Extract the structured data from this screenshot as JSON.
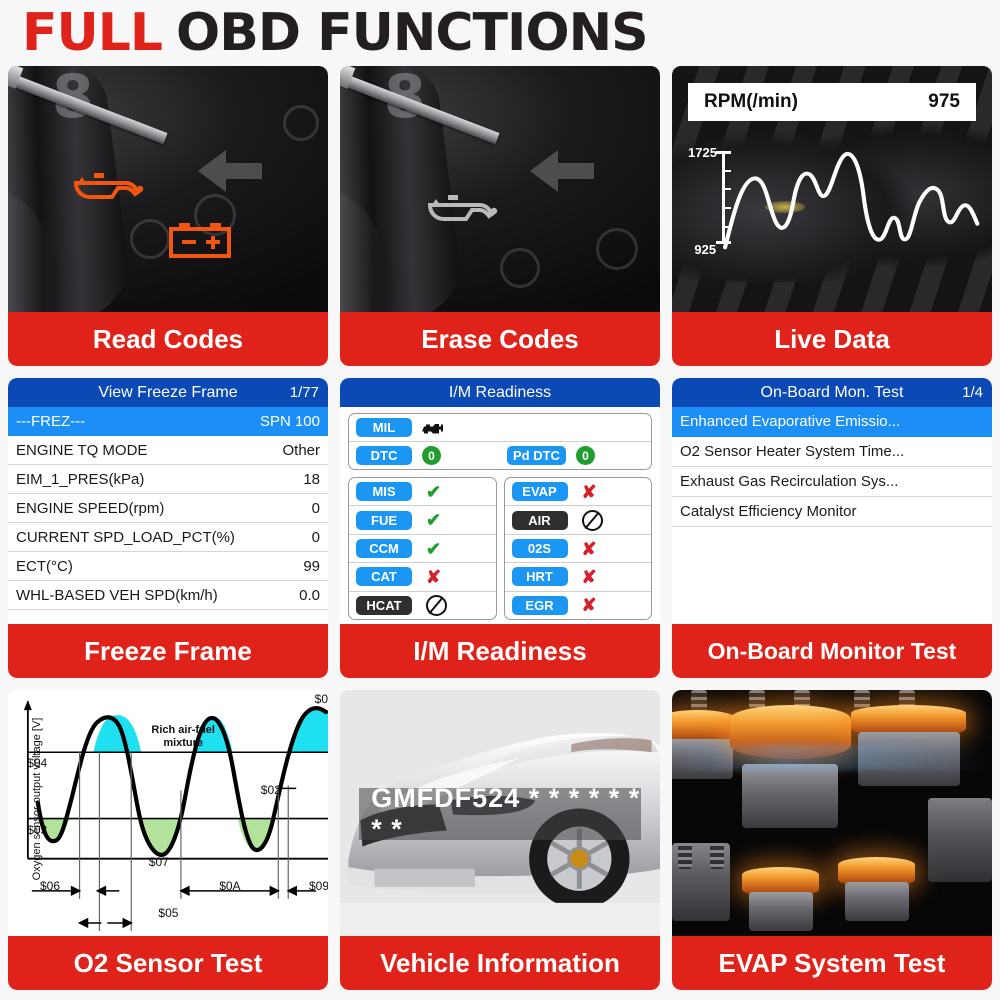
{
  "title": {
    "accent_word": "FULL",
    "rest": "OBD FUNCTIONS",
    "accent_color": "#e0231a",
    "text_color": "#231f20"
  },
  "theme": {
    "label_red": "#e0231a",
    "header_blue": "#0b49b5",
    "select_blue": "#1b8ff5",
    "badge_blue": "#1b96f3",
    "badge_dark": "#2f2f2f",
    "ok_green": "#1f9d2f",
    "fail_red": "#d4212a",
    "page_bg": "#f7f7f7"
  },
  "cards": {
    "read_codes": {
      "label": "Read Codes",
      "icons": [
        "oil-pressure-warning-icon",
        "battery-warning-icon"
      ],
      "icon_color": "#f2550f"
    },
    "erase_codes": {
      "label": "Erase Codes",
      "icons": [
        "oil-pressure-warning-icon"
      ],
      "icon_color": "#b9b9bd"
    },
    "live_data": {
      "label": "Live Data",
      "readout_name": "RPM(/min)",
      "readout_value": "975",
      "axis_max": "1725",
      "axis_min": "925"
    },
    "freeze_frame": {
      "label": "Freeze Frame",
      "header": "View Freeze Frame",
      "page": "1/77",
      "selected": {
        "name": "---FREZ---",
        "value": "SPN 100"
      },
      "rows": [
        {
          "name": "ENGINE TQ MODE",
          "value": "Other"
        },
        {
          "name": "EIM_1_PRES(kPa)",
          "value": "18"
        },
        {
          "name": "ENGINE SPEED(rpm)",
          "value": "0"
        },
        {
          "name": "CURRENT SPD_LOAD_PCT(%)",
          "value": "0"
        },
        {
          "name": "ECT(°C)",
          "value": "99"
        },
        {
          "name": "WHL-BASED VEH SPD(km/h)",
          "value": "0.0"
        }
      ]
    },
    "im_readiness": {
      "label": "I/M Readiness",
      "header": "I/M Readiness",
      "mil": {
        "badge": "MIL",
        "status": "engine-icon"
      },
      "dtc": {
        "badge": "DTC",
        "value": "0"
      },
      "pd_dtc": {
        "badge": "Pd DTC",
        "value": "0"
      },
      "left_column": [
        {
          "badge": "MIS",
          "status": "ok",
          "dark": false
        },
        {
          "badge": "FUE",
          "status": "ok",
          "dark": false
        },
        {
          "badge": "CCM",
          "status": "ok",
          "dark": false
        },
        {
          "badge": "CAT",
          "status": "fail",
          "dark": false
        },
        {
          "badge": "HCAT",
          "status": "na",
          "dark": true
        }
      ],
      "right_column": [
        {
          "badge": "EVAP",
          "status": "fail",
          "dark": false
        },
        {
          "badge": "AIR",
          "status": "na",
          "dark": true
        },
        {
          "badge": "02S",
          "status": "fail",
          "dark": false
        },
        {
          "badge": "HRT",
          "status": "fail",
          "dark": false
        },
        {
          "badge": "EGR",
          "status": "fail",
          "dark": false
        }
      ]
    },
    "on_board": {
      "label": "On-Board Monitor Test",
      "header": "On-Board Mon. Test",
      "page": "1/4",
      "items": [
        "Enhanced Evaporative Emissio...",
        "O2 Sensor Heater System Time...",
        "Exhaust Gas Recirculation Sys...",
        "Catalyst Efficiency Monitor"
      ]
    },
    "o2_sensor": {
      "label": "O2 Sensor Test",
      "ylabel": "Oxygen sensor output voltage [V]",
      "annotation": "Rich air-fuel mixture",
      "markers": {
        "upper_threshold": "$04",
        "lower_threshold": "$03",
        "min_value": "$07",
        "max_value": "$0",
        "mid_marker": "$02",
        "time_low_to_high": "$06",
        "time_high_to_low": "$05",
        "period_long": "$0A",
        "period_short": "$09"
      }
    },
    "vehicle_info": {
      "label": "Vehicle Information",
      "vin": "GMFDF524 * * * * * * * *"
    },
    "evap_system": {
      "label": "EVAP System Test"
    }
  }
}
